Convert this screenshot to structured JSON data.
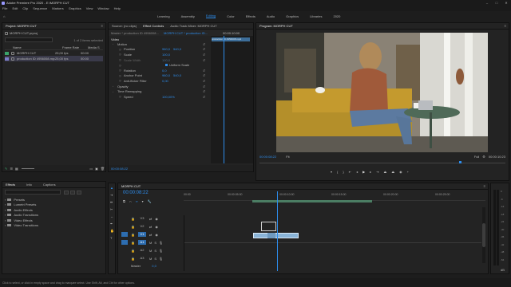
{
  "titlebar": {
    "title": "Adobe Premiere Pro 2020 - E:\\MORPH CUT"
  },
  "menu": [
    "File",
    "Edit",
    "Clip",
    "Sequence",
    "Markers",
    "Graphics",
    "View",
    "Window",
    "Help"
  ],
  "workspaces": [
    "Learning",
    "Assembly",
    "Editing",
    "Color",
    "Effects",
    "Audio",
    "Graphics",
    "Libraries",
    "2020"
  ],
  "active_workspace": "Editing",
  "project": {
    "tab": "Project: MORPH CUT",
    "path": "MORPH CUT.prproj",
    "count": "1 of 2 items selected",
    "columns": [
      "Name",
      "Frame Rate",
      "Media S"
    ],
    "items": [
      {
        "name": "MORPH CUT",
        "fps": "25,00 fps",
        "start": "00:00"
      },
      {
        "name": "production ID 4956008.mp4",
        "fps": "25,00 fps",
        "start": "00:00"
      }
    ]
  },
  "effect_controls": {
    "tabs": [
      "Source: (no clips)",
      "Effect Controls",
      "Audio Track Mixer: MORPH CUT"
    ],
    "active_tab": "Effect Controls",
    "master": "Master * production ID 4956008...",
    "sequence": "MORPH CUT * production ID...",
    "timecode_head": "00:00:10:00",
    "clip_label": "production ID 4956008.mp4",
    "section_video": "Video",
    "fx": [
      {
        "name": "Motion",
        "value": "",
        "value2": "",
        "kind": "group"
      },
      {
        "name": "Position",
        "value": "960,0",
        "value2": "540,0",
        "kind": "prop"
      },
      {
        "name": "Scale",
        "value": "100,0",
        "value2": "",
        "kind": "prop"
      },
      {
        "name": "Scale Width",
        "value": "100,0",
        "value2": "",
        "kind": "dim"
      },
      {
        "name": "",
        "value": "Uniform Scale",
        "value2": "",
        "kind": "check"
      },
      {
        "name": "Rotation",
        "value": "0,0",
        "value2": "",
        "kind": "prop"
      },
      {
        "name": "Anchor Point",
        "value": "960,0",
        "value2": "540,0",
        "kind": "prop"
      },
      {
        "name": "Anti-flicker Filter",
        "value": "0,00",
        "value2": "",
        "kind": "prop"
      },
      {
        "name": "Opacity",
        "value": "",
        "value2": "",
        "kind": "group"
      },
      {
        "name": "Time Remapping",
        "value": "",
        "value2": "",
        "kind": "group"
      },
      {
        "name": "Speed",
        "value": "100,00%",
        "value2": "",
        "kind": "prop"
      }
    ],
    "footer_tc": "00:00:08:22"
  },
  "program": {
    "tab": "Program: MORPH CUT",
    "timecode": "00:00:08:22",
    "fit": "Fit",
    "quality": "Full",
    "duration": "00:00:10:23"
  },
  "effects_panel": {
    "tabs": [
      "Effects",
      "Info",
      "Captions"
    ],
    "active_tab": "Effects",
    "items": [
      "Presets",
      "Lumetri Presets",
      "Audio Effects",
      "Audio Transitions",
      "Video Effects",
      "Video Transitions"
    ]
  },
  "timeline": {
    "tab": "MORPH CUT",
    "timecode": "00:00:08:22",
    "ruler": [
      "00:00",
      "00:00:05:00",
      "00:00:10:00",
      "00:00:15:00",
      "00:00:20:00",
      "00:00:25:00"
    ],
    "tracks": [
      "V3",
      "V2",
      "V1",
      "A1",
      "A2",
      "A3"
    ],
    "master_label": "Master",
    "master_value": "0,0",
    "db_scale": [
      "0",
      "-6",
      "-12",
      "-18",
      "-24",
      "-30",
      "-36",
      "-42",
      "-48",
      "-54"
    ],
    "db_unit": "dB"
  },
  "status": {
    "text": "Click to select, or click in empty space and drag to marquee select. Use Shift, Alt, and Ctrl for other options."
  },
  "colors": {
    "accent": "#2d8ceb",
    "clip": "#8ab4d8",
    "bg": "#1d1d1d",
    "panel": "#232323"
  }
}
